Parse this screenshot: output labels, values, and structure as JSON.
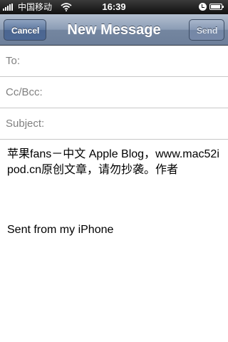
{
  "status_bar": {
    "carrier": "中国移动",
    "time": "16:39",
    "icons": [
      "signal-bars-icon",
      "wifi-icon",
      "lock-rotation-icon",
      "battery-icon"
    ]
  },
  "nav_bar": {
    "title": "New Message",
    "cancel_label": "Cancel",
    "send_label": "Send"
  },
  "fields": {
    "to_label": "To:",
    "cc_label": "Cc/Bcc:",
    "subject_label": "Subject:"
  },
  "body": {
    "text": "苹果fans－中文 Apple Blog，www.mac52ipod.cn原创文章，请勿抄袭。作者",
    "signature": "Sent from my iPhone"
  },
  "colors": {
    "nav_bar": "#8b9cb5",
    "cancel_button": "#5e78a0",
    "label_gray": "#808080",
    "separator": "#c8c8c8"
  }
}
